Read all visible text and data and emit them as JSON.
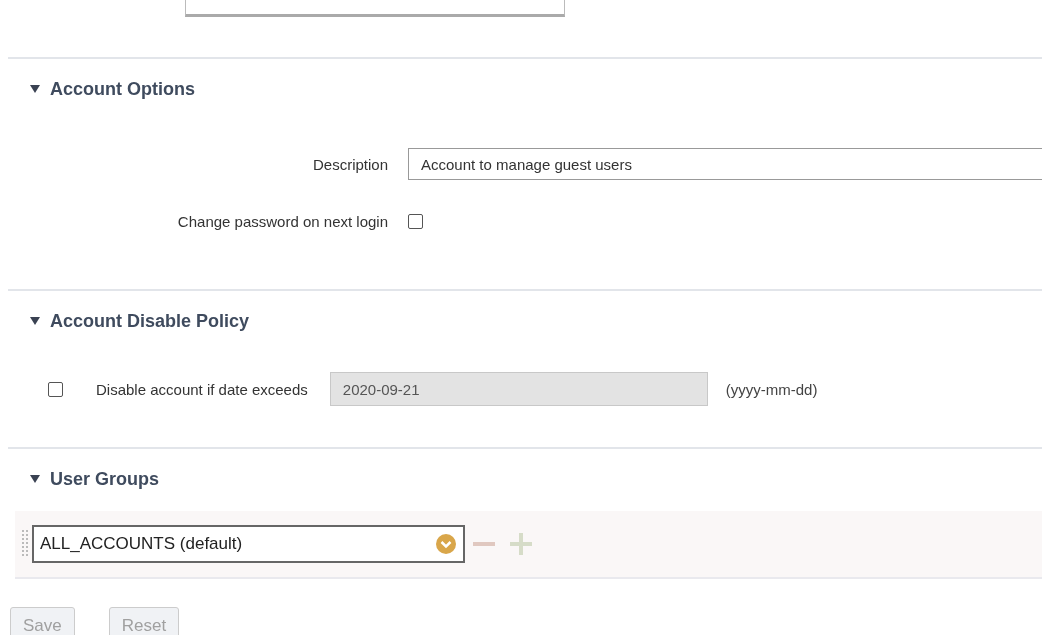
{
  "account_options": {
    "title": "Account Options",
    "expanded": true,
    "description": {
      "label": "Description",
      "value": "Account to manage guest users"
    },
    "change_password": {
      "label": "Change password on next login",
      "checked": false
    }
  },
  "account_disable_policy": {
    "title": "Account Disable Policy",
    "expanded": true,
    "disable_if_date_exceeds": {
      "label": "Disable account if date exceeds",
      "checked": false,
      "value": "2020-09-21",
      "disabled": true,
      "format_hint": "(yyyy-mm-dd)"
    }
  },
  "user_groups": {
    "title": "User Groups",
    "expanded": true,
    "groups": [
      {
        "value": "ALL_ACCOUNTS (default)"
      }
    ]
  },
  "buttons": [
    {
      "label": "Save",
      "disabled": true
    },
    {
      "label": "Reset",
      "disabled": true
    }
  ]
}
